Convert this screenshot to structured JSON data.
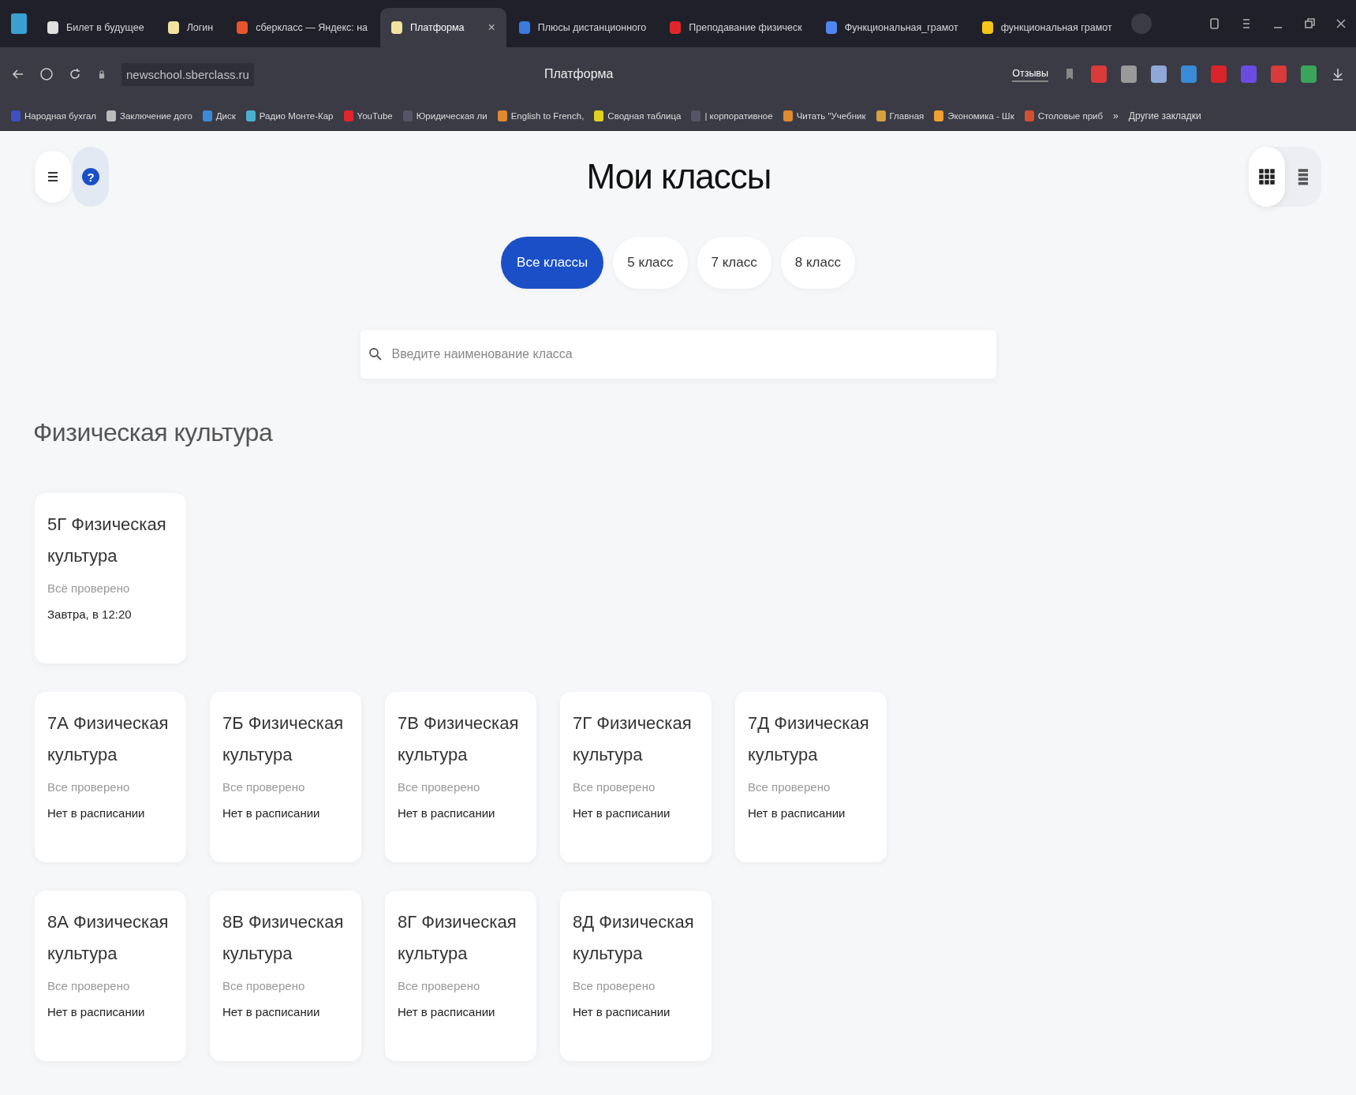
{
  "browser": {
    "tabs": [
      {
        "title": "Билет в будущее",
        "selected": false,
        "color": "#e0e0e0"
      },
      {
        "title": "Логин",
        "selected": false,
        "color": "#f2e2a0"
      },
      {
        "title": "сберкласс — Яндекс: на",
        "selected": false,
        "color": "#e8552d"
      },
      {
        "title": "Платформа",
        "selected": true,
        "color": "#f2e2a0",
        "close": "×"
      },
      {
        "title": "Плюсы дистанционного",
        "selected": false,
        "color": "#3b7be0"
      },
      {
        "title": "Преподавание физическ",
        "selected": false,
        "color": "#e0262a"
      },
      {
        "title": "Функциональная_грамот",
        "selected": false,
        "color": "#4f86f0"
      },
      {
        "title": "функциональная грамот",
        "selected": false,
        "color": "#f5c518"
      }
    ],
    "url": "newschool.sberclass.ru",
    "page_title": "Платформа",
    "feedback": "Отзывы",
    "extensions": [
      {
        "color": "#d93a3a"
      },
      {
        "color": "#9a9a9a"
      },
      {
        "color": "#8fa8d8"
      },
      {
        "color": "#3a8ad8"
      },
      {
        "color": "#d9242a"
      },
      {
        "color": "#6a4de0"
      },
      {
        "color": "#d93a3a"
      },
      {
        "color": "#3aa55a"
      }
    ],
    "bookmarks": [
      {
        "title": "Народная бухгал",
        "color": "#4050c0"
      },
      {
        "title": "Заключение дого",
        "color": "#bbbbbb"
      },
      {
        "title": "Диск",
        "color": "#3a8ad8"
      },
      {
        "title": "Радио Монте-Кар",
        "color": "#4ab0d0"
      },
      {
        "title": "YouTube",
        "color": "#e0262a"
      },
      {
        "title": "Юридическая ли",
        "color": "#555566"
      },
      {
        "title": "English to French,",
        "color": "#e08a30"
      },
      {
        "title": "Сводная таблица",
        "color": "#e0d020"
      },
      {
        "title": "| корпоративное",
        "color": "#555566"
      },
      {
        "title": "Читать \"Учебник",
        "color": "#e08a30"
      },
      {
        "title": "Главная",
        "color": "#d8a040"
      },
      {
        "title": "Экономика - Шк",
        "color": "#f0a030"
      },
      {
        "title": "Столовые приб",
        "color": "#d05030"
      }
    ],
    "more": "»",
    "other_bookmarks": "Другие закладки"
  },
  "page": {
    "title": "Мои классы",
    "help": "?",
    "filters": [
      {
        "label": "Все классы",
        "selected": true
      },
      {
        "label": "5 класс",
        "selected": false
      },
      {
        "label": "7 класс",
        "selected": false
      },
      {
        "label": "8 класс",
        "selected": false
      }
    ],
    "view_modes": [
      {
        "kind": "grid",
        "selected": true
      },
      {
        "kind": "list",
        "selected": false
      }
    ],
    "search": {
      "placeholder": "Введите наименование класса"
    },
    "section": {
      "title": "Физическая культура",
      "rows": [
        [
          {
            "name": "5Г Физическая культура",
            "status": "Всё проверено",
            "schedule": "Завтра, в 12:20"
          }
        ],
        [
          {
            "name": "7А Физическая культура",
            "status": "Все проверено",
            "schedule": "Нет в расписании"
          },
          {
            "name": "7Б Физическая культура",
            "status": "Все проверено",
            "schedule": "Нет в расписании"
          },
          {
            "name": "7В Физическая культура",
            "status": "Все проверено",
            "schedule": "Нет в расписании"
          },
          {
            "name": "7Г Физическая культура",
            "status": "Все проверено",
            "schedule": "Нет в расписании"
          },
          {
            "name": "7Д Физическая культура",
            "status": "Все проверено",
            "schedule": "Нет в расписании"
          }
        ],
        [
          {
            "name": "8А Физическая культура",
            "status": "Все проверено",
            "schedule": "Нет в расписании"
          },
          {
            "name": "8В Физическая культура",
            "status": "Все проверено",
            "schedule": "Нет в расписании"
          },
          {
            "name": "8Г Физическая культура",
            "status": "Все проверено",
            "schedule": "Нет в расписании"
          },
          {
            "name": "8Д Физическая культура",
            "status": "Все проверено",
            "schedule": "Нет в расписании"
          }
        ]
      ]
    }
  }
}
